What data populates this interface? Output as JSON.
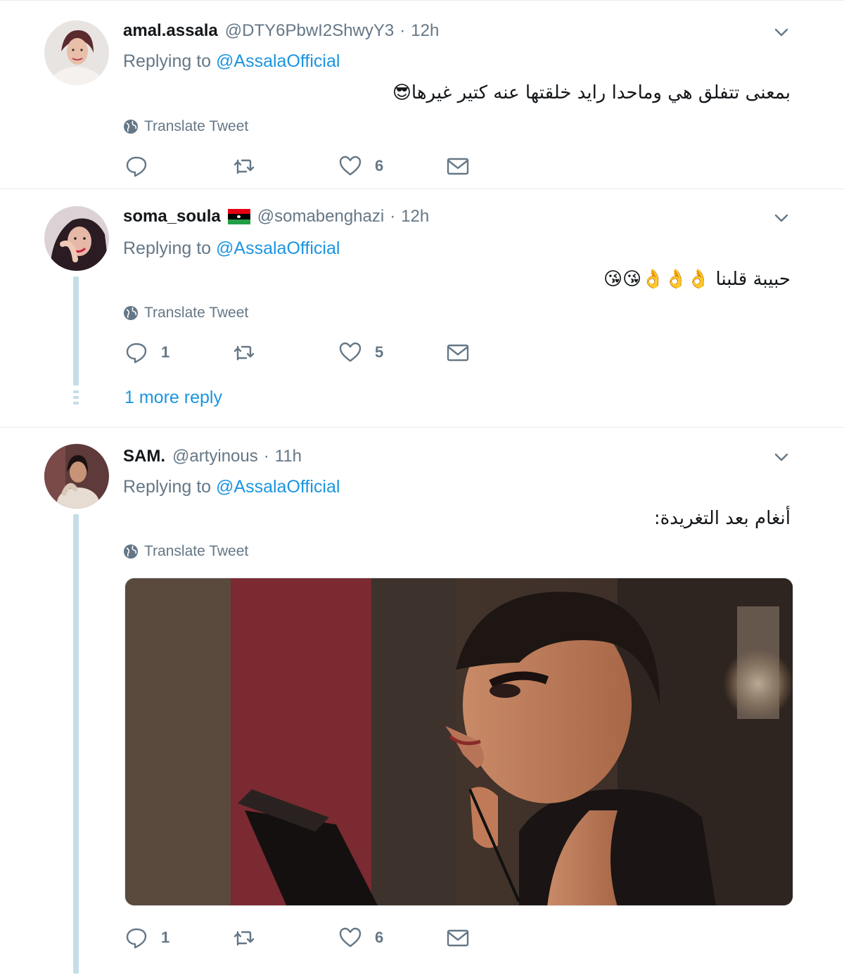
{
  "tweets": [
    {
      "name": "amal.assala",
      "handle": "@DTY6PbwI2ShwyY3",
      "separator": "·",
      "time": "12h",
      "replying_prefix": "Replying to ",
      "replying_to": "@AssalaOfficial",
      "text": "بمعنى تتفلق هي وماحدا رايد خلقتها عنه كتير غيرها😎",
      "translate_label": "Translate Tweet",
      "reply_count": "",
      "retweet_count": "",
      "like_count": "6"
    },
    {
      "name": "soma_soula",
      "flag": "libya-flag",
      "handle": "@somabenghazi",
      "separator": "·",
      "time": "12h",
      "replying_prefix": "Replying to ",
      "replying_to": "@AssalaOfficial",
      "text": "حبيبة قلبنا 👌👌👌😘😘",
      "translate_label": "Translate Tweet",
      "reply_count": "1",
      "retweet_count": "",
      "like_count": "5",
      "more_replies": "1 more reply"
    },
    {
      "name": "SAM.",
      "handle": "@artyinous",
      "separator": "·",
      "time": "11h",
      "replying_prefix": "Replying to ",
      "replying_to": "@AssalaOfficial",
      "text": "أنغام بعد التغريدة:",
      "translate_label": "Translate Tweet",
      "media": "gif-woman-short-hair-clipboard",
      "reply_count": "1",
      "retweet_count": "",
      "like_count": "6"
    }
  ],
  "colors": {
    "link": "#1b95e0",
    "muted": "#657786",
    "thread_line": "#c4dde9",
    "divider": "#e6ecf0"
  }
}
